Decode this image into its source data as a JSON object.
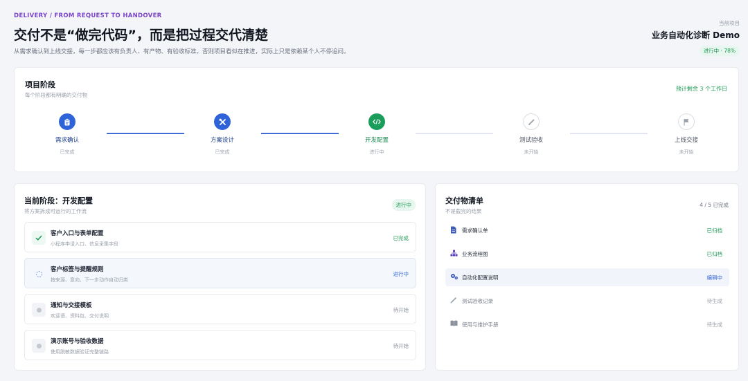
{
  "header": {
    "eyebrow": "DELIVERY / FROM REQUEST TO HANDOVER",
    "title": "交付不是“做完代码”，而是把过程交代清楚",
    "subtitle": "从需求确认到上线交接，每一步都应该有负责人、有产物、有验收标准。否则项目看似在推进，实际上只是依赖某个人不停追问。"
  },
  "project": {
    "label": "当前项目",
    "name": "业务自动化诊断 Demo",
    "status": "进行中 · 78%",
    "progress_percent": 78
  },
  "stages": {
    "title": "项目阶段",
    "subtitle": "每个阶段都有明确的交付物",
    "eta": "预计剩余 3 个工作日",
    "items": [
      {
        "name": "需求确认",
        "state": "已完成",
        "icon": "clipboard-icon",
        "status": "done"
      },
      {
        "name": "方案设计",
        "state": "已完成",
        "icon": "tools-icon",
        "status": "done"
      },
      {
        "name": "开发配置",
        "state": "进行中",
        "icon": "code-icon",
        "status": "active"
      },
      {
        "name": "测试验收",
        "state": "未开始",
        "icon": "pencil-icon",
        "status": "todo"
      },
      {
        "name": "上线交接",
        "state": "未开始",
        "icon": "flag-icon",
        "status": "todo"
      }
    ]
  },
  "current": {
    "title": "当前阶段：开发配置",
    "subtitle": "将方案拆成可运行的工作流",
    "status": "进行中",
    "tasks": [
      {
        "title": "客户入口与表单配置",
        "desc": "小程序申请入口、信息采集字段",
        "status": "已完成",
        "icon": "check-icon",
        "state": "done"
      },
      {
        "title": "客户标签与提醒规则",
        "desc": "按来源、意向、下一步动作自动归类",
        "status": "进行中",
        "icon": "spinner-icon",
        "state": "active"
      },
      {
        "title": "通知与交接模板",
        "desc": "欢迎语、资料包、交付说明",
        "status": "待开始",
        "icon": "dot-icon",
        "state": "todo"
      },
      {
        "title": "演示账号与验收数据",
        "desc": "使用脱敏数据验证完整链路",
        "status": "待开始",
        "icon": "dot-icon",
        "state": "todo"
      }
    ]
  },
  "deliverables": {
    "title": "交付物清单",
    "subtitle": "不是截完的结果",
    "count": "4 / 5 已完成",
    "items": [
      {
        "name": "需求确认单",
        "status": "已归档",
        "icon": "document-icon",
        "state": "archived"
      },
      {
        "name": "业务流程图",
        "status": "已归档",
        "icon": "flowchart-icon",
        "state": "archived"
      },
      {
        "name": "自动化配置说明",
        "status": "编辑中",
        "icon": "gears-icon",
        "state": "editing"
      },
      {
        "name": "测试验收记录",
        "status": "待生成",
        "icon": "pencil-icon",
        "state": "pending"
      },
      {
        "name": "使用与维护手册",
        "status": "待生成",
        "icon": "book-icon",
        "state": "pending"
      }
    ]
  }
}
